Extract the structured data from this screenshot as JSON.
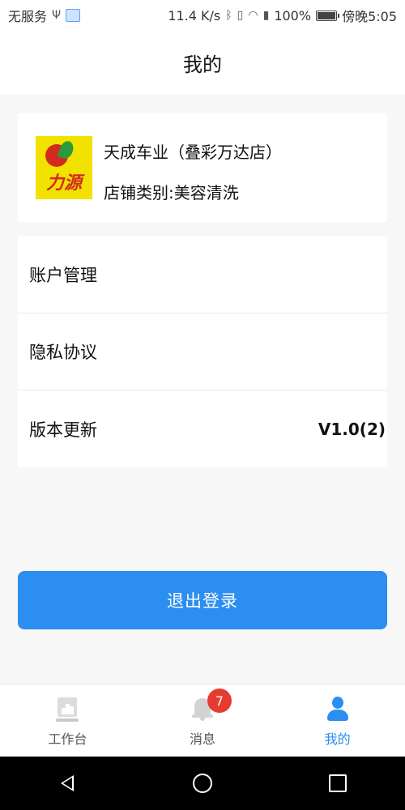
{
  "status_bar": {
    "carrier": "无服务",
    "speed": "11.4 K/s",
    "battery": "100%",
    "time": "傍晚5:05"
  },
  "header": {
    "title": "我的"
  },
  "shop": {
    "logo_text": "力源",
    "name": "天成车业（叠彩万达店）",
    "category": "店铺类别:美容清洗"
  },
  "menu": {
    "items": [
      {
        "label": "账户管理",
        "value": ""
      },
      {
        "label": "隐私协议",
        "value": ""
      },
      {
        "label": "版本更新",
        "value": "V1.0(2)"
      }
    ]
  },
  "logout": {
    "label": "退出登录"
  },
  "tabbar": {
    "tabs": [
      {
        "label": "工作台",
        "icon": "workbench-icon"
      },
      {
        "label": "消息",
        "icon": "bell-icon",
        "badge": "7"
      },
      {
        "label": "我的",
        "icon": "user-icon"
      }
    ],
    "active": "我的"
  },
  "colors": {
    "accent": "#2b8ef0",
    "badge": "#e53b30",
    "background": "#f7f7f7"
  }
}
